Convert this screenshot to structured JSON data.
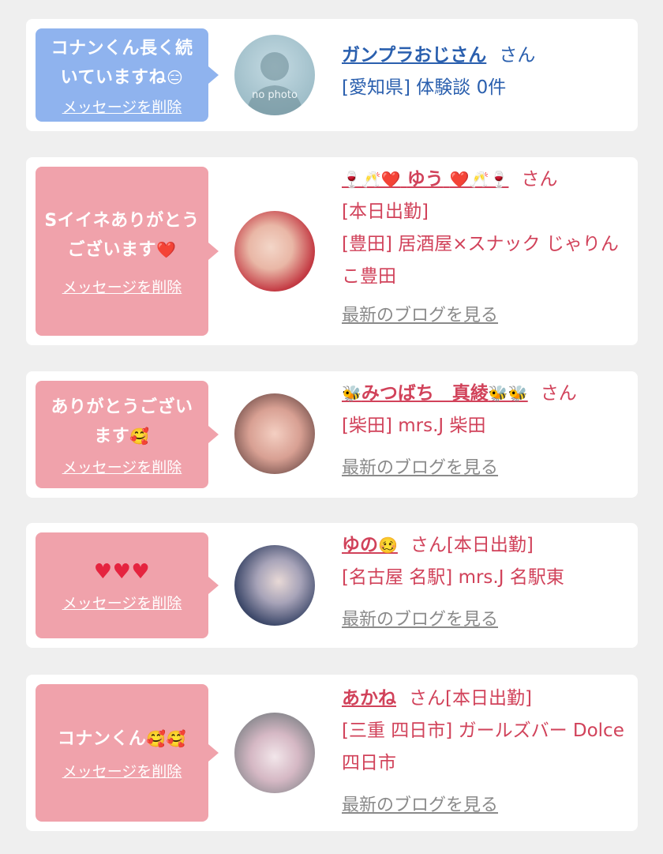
{
  "cards": [
    {
      "message": "コナンくん長く続いていますね",
      "message_emoji": "😑",
      "delete_label": "メッセージを削除",
      "name": "ガンプラおじさん",
      "honorific": "さん",
      "details": [
        "[愛知県] 体験談 0件"
      ],
      "avatar_text": "no photo"
    },
    {
      "message": "Sイイネありがとうございます",
      "message_emoji": "❤️",
      "delete_label": "メッセージを削除",
      "name_prefix": "🍷🥂❤️",
      "name": "ゆう",
      "name_suffix": "❤️🥂🍷",
      "honorific": "さん",
      "details": [
        "[本日出勤]",
        "[豊田] 居酒屋×スナック じゃりんこ豊田"
      ],
      "blog_link": "最新のブログを見る"
    },
    {
      "message": "ありがとうございます",
      "message_emoji": "🥰",
      "delete_label": "メッセージを削除",
      "name_prefix": "🐝",
      "name": "みつばち　真綾",
      "name_suffix": "🐝🐝",
      "honorific": "さん",
      "details": [
        "[柴田] mrs.J 柴田"
      ],
      "blog_link": "最新のブログを見る"
    },
    {
      "message": "♥♥♥",
      "delete_label": "メッセージを削除",
      "name": "ゆの",
      "name_suffix": "🥴",
      "honorific": "さん[本日出勤]",
      "details": [
        "[名古屋 名駅] mrs.J 名駅東"
      ],
      "blog_link": "最新のブログを見る"
    },
    {
      "message": "コナンくん",
      "message_emoji": "🥰🥰",
      "delete_label": "メッセージを削除",
      "name": "あかね",
      "honorific": "さん[本日出勤]",
      "details": [
        "[三重 四日市] ガールズバー Dolce 四日市"
      ],
      "blog_link": "最新のブログを見る"
    }
  ],
  "colors": {
    "page_bg": "#efefef",
    "bubble_blue": "#8fb3ee",
    "bubble_pink": "#f0a2ab",
    "name_blue": "#2a5fae",
    "name_pink": "#d1425a",
    "blog_gray": "#8a8a8a"
  }
}
